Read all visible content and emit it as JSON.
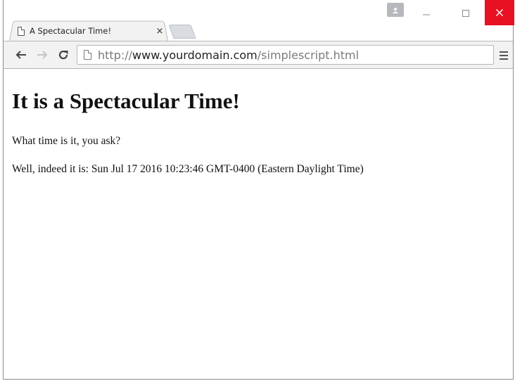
{
  "browser": {
    "tab": {
      "title": "A Spectacular Time!",
      "close_glyph": "×"
    },
    "window_controls": {
      "minimize": "—",
      "maximize": "☐",
      "close": "✕"
    },
    "address_bar": {
      "scheme": "http://",
      "domain": "www.yourdomain.com",
      "path": "/simplescript.html"
    },
    "icons": {
      "back": "arrow-left-icon",
      "forward": "arrow-right-icon",
      "reload": "reload-icon",
      "page": "page-icon",
      "menu": "hamburger-menu-icon",
      "profile": "user-profile-icon"
    },
    "colors": {
      "close_button": "#e81123",
      "toolbar_bg": "#f2f2f2"
    }
  },
  "page": {
    "heading": "It is a Spectacular Time!",
    "question": "What time is it, you ask?",
    "answer": "Well, indeed it is: Sun Jul 17 2016 10:23:46 GMT-0400 (Eastern Daylight Time)"
  }
}
